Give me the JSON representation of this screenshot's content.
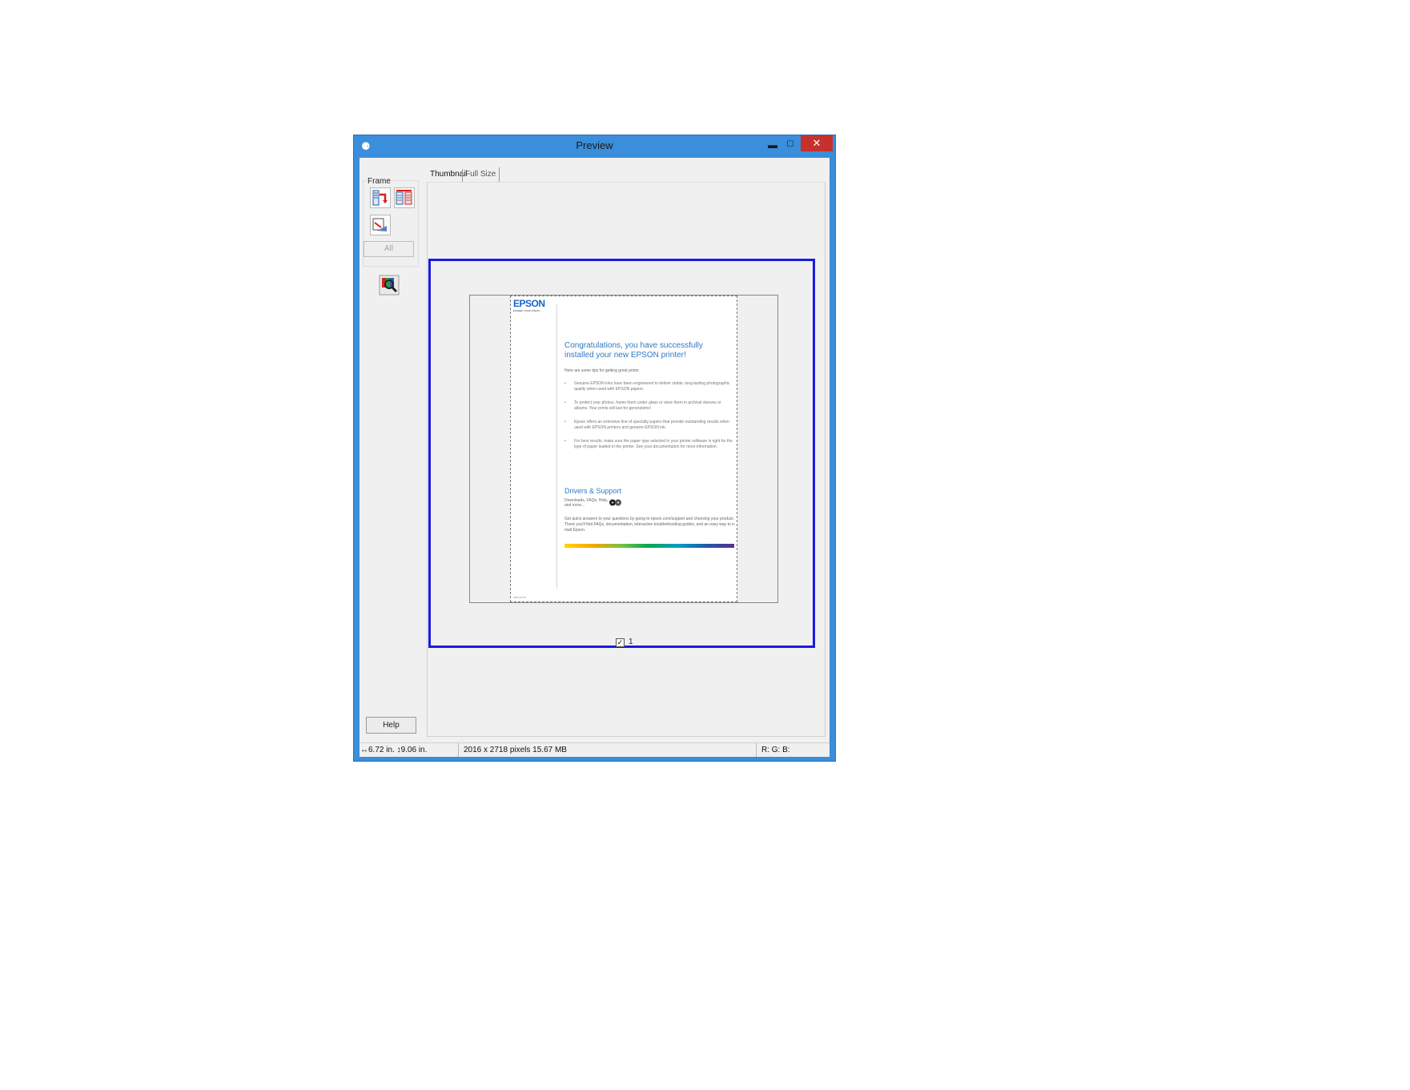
{
  "window": {
    "title": "Preview",
    "title_icon": "scanner-app-icon",
    "controls": {
      "minimize": "minimize-icon",
      "maximize": "maximize-icon",
      "close": "close-icon"
    }
  },
  "left_panel": {
    "frame_label": "Frame",
    "tools": [
      "auto-locate-icon",
      "select-all-frames-icon",
      "rotate-frame-icon"
    ],
    "all_button": "All",
    "zoom_tool": "zoom-preview-icon",
    "help_button": "Help"
  },
  "tabs": {
    "thumbnail": "Thumbnail",
    "full_size": "Full Size",
    "active": "Thumbnail"
  },
  "thumbnail": {
    "page_checked": true,
    "page_number": "1",
    "document": {
      "logo": "EPSON",
      "logo_tagline": "EXCEED YOUR VISION",
      "headline": "Congratulations, you have successfully installed your new EPSON printer!",
      "intro": "Here are some tips for getting great prints:",
      "bullets": [
        "Genuine EPSON inks have been engineered to deliver stable, long-lasting photographic quality when used with EPSON papers.",
        "To protect your photos, frame them under glass or store them in archival sleeves or albums. Your prints will last for generations!",
        "Epson offers an extensive line of specialty papers that provide outstanding results when used with EPSON printers and genuine EPSON ink.",
        "For best results, make sure the paper type selected in your printer software is right for the type of paper loaded in the printer. See your documentation for more information."
      ],
      "subhead": "Drivers & Support",
      "downloads_note": "Downloads, FAQs, Help, and more...",
      "support_text": "Get quick answers to your questions by going to epson.com/support and choosing your product. There you'll find FAQs, documentation, interactive troubleshooting guides, and an easy way to e-mail Epson.",
      "footnote": "CPD-27772"
    }
  },
  "status": {
    "width_icon": "horizontal-arrow-icon",
    "width": "6.72 in.",
    "height_icon": "vertical-arrow-icon",
    "height": "9.06 in.",
    "pixels": "2016 x 2718 pixels 15.67 MB",
    "rgb": "R: G: B:"
  },
  "colors": {
    "titlebar": "#3a8edb",
    "close": "#c7312b",
    "selection_frame": "#1a1ae0",
    "epson_blue": "#2e79c6"
  }
}
